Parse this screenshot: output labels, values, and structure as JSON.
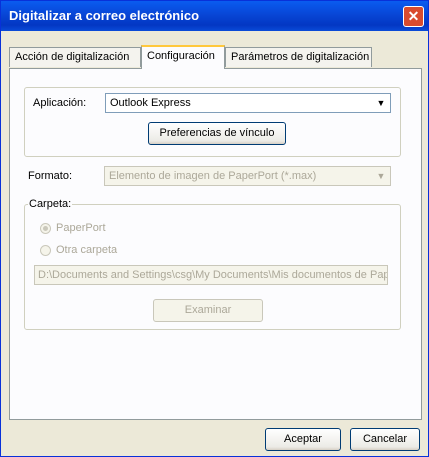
{
  "window": {
    "title": "Digitalizar a correo electrónico",
    "close_glyph": "✕"
  },
  "tabs": [
    {
      "label": "Acción de digitalización"
    },
    {
      "label": "Configuración"
    },
    {
      "label": "Parámetros de digitalización"
    }
  ],
  "aplicacion": {
    "label": "Aplicación:",
    "value": "Outlook Express",
    "link_button": "Preferencias de vínculo"
  },
  "formato": {
    "label": "Formato:",
    "value": "Elemento de imagen de PaperPort (*.max)"
  },
  "carpeta": {
    "label": "Carpeta:",
    "option_paperport": "PaperPort",
    "option_otra": "Otra carpeta",
    "path": "D:\\Documents and Settings\\csg\\My Documents\\Mis documentos de PaperPort",
    "browse_button": "Examinar"
  },
  "footer": {
    "ok": "Aceptar",
    "cancel": "Cancelar"
  }
}
